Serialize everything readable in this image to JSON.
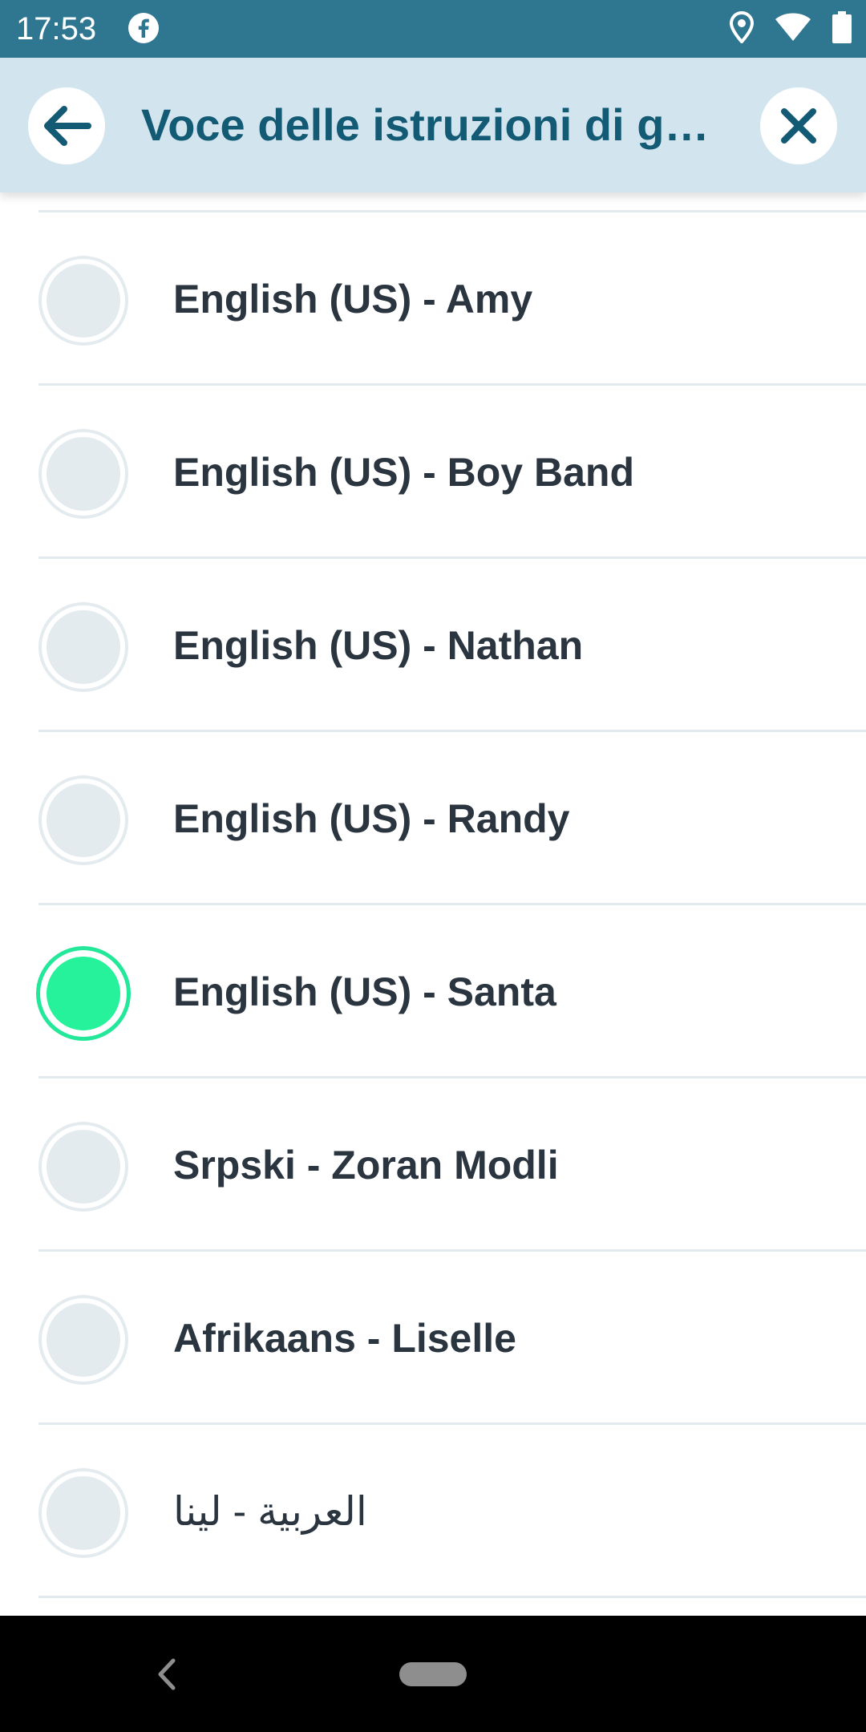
{
  "status_bar": {
    "time": "17:53",
    "icons": [
      "facebook-icon",
      "location-icon",
      "wifi-icon",
      "battery-icon"
    ]
  },
  "toolbar": {
    "title": "Voce delle istruzioni di guida",
    "back_icon": "arrow-left-icon",
    "close_icon": "close-icon"
  },
  "voices": [
    {
      "label": "English (US) - Amy",
      "selected": false
    },
    {
      "label": "English (US) - Boy Band",
      "selected": false
    },
    {
      "label": "English (US) - Nathan",
      "selected": false
    },
    {
      "label": "English (US) - Randy",
      "selected": false
    },
    {
      "label": "English (US) - Santa",
      "selected": true
    },
    {
      "label": "Srpski - Zoran Modli",
      "selected": false
    },
    {
      "label": "Afrikaans - Liselle",
      "selected": false
    },
    {
      "label": "العربية - لينا",
      "selected": false
    }
  ],
  "colors": {
    "status_bar": "#2f7791",
    "toolbar": "#d2e5ee",
    "title_text": "#135a75",
    "selected_radio": "#25f29a",
    "unselected_radio": "#e3ebef"
  }
}
